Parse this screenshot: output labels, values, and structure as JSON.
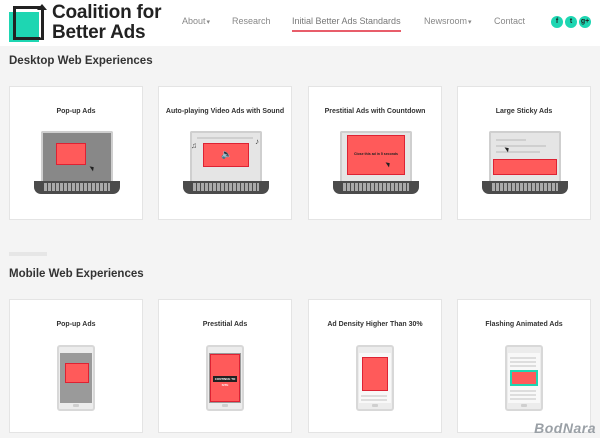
{
  "header": {
    "logo_line1": "Coalition for",
    "logo_line2": "Better Ads",
    "nav": [
      {
        "label": "About",
        "caret": "▾"
      },
      {
        "label": "Research",
        "caret": ""
      },
      {
        "label": "Initial Better Ads Standards",
        "caret": ""
      },
      {
        "label": "Newsroom",
        "caret": "▾"
      },
      {
        "label": "Contact",
        "caret": ""
      }
    ],
    "social": [
      "f",
      "t",
      "g+"
    ]
  },
  "desktop": {
    "heading": "Desktop Web Experiences",
    "cards": [
      {
        "title": "Pop-up Ads"
      },
      {
        "title": "Auto-playing Video Ads with Sound"
      },
      {
        "title": "Prestitial Ads with Countdown",
        "ad_text": "Close this ad in 5 seconds"
      },
      {
        "title": "Large Sticky Ads"
      }
    ]
  },
  "mobile": {
    "heading": "Mobile Web Experiences",
    "cards": [
      {
        "title": "Pop-up Ads"
      },
      {
        "title": "Prestitial Ads",
        "ad_text": "CONTINUE TO SITE"
      },
      {
        "title": "Ad Density Higher Than 30%"
      },
      {
        "title": "Flashing Animated Ads"
      }
    ]
  },
  "watermark": "BodNara",
  "colors": {
    "accent": "#1ed6b2",
    "ad": "#ff5a5a",
    "nav_underline": "#e85d6a"
  }
}
